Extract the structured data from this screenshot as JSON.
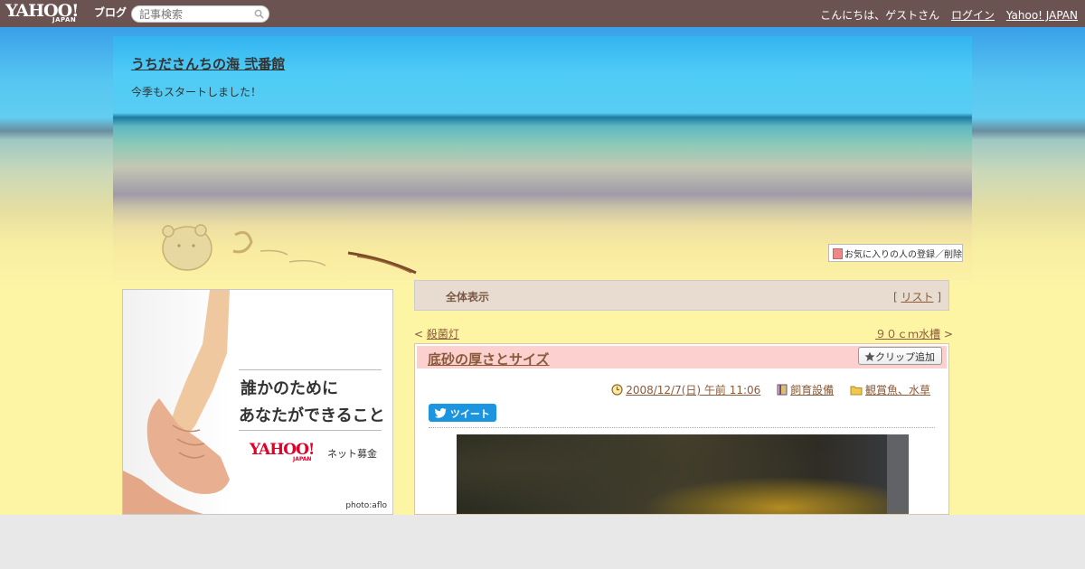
{
  "topbar": {
    "logo": "YAHOO!",
    "logo_sub": "JAPAN",
    "logo_blog": "ブログ",
    "search_placeholder": "記事検索",
    "greeting": "こんにちは、ゲストさん",
    "login_label": "ログイン",
    "yahoo_japan_label": "Yahoo! JAPAN"
  },
  "header": {
    "blog_title": "うちださんちの海 弐番館",
    "blog_description": "今季もスタートしました！",
    "favorite_label": "お気に入りの人の登録／削除"
  },
  "ad": {
    "line1": "誰かのために",
    "line2": "あなたができること",
    "brand": "YAHOO!",
    "brand_sub": "JAPAN",
    "service": "ネット募金",
    "credit": "photo:aflo"
  },
  "filter": {
    "label": "全体表示",
    "list_label": "リスト"
  },
  "nav": {
    "prev_label": "殺菌灯",
    "next_label": "９０ｃｍ水槽"
  },
  "article": {
    "title": "底砂の厚さとサイズ",
    "clip_label": "クリップ追加",
    "date": "2008/12/7(日) 午前 11:06",
    "category": "飼育設備",
    "folder": "観賞魚、水草",
    "tweet_label": "ツイート"
  },
  "colors": {
    "topbar": "#6b5352",
    "accent_link": "#8a5a3a",
    "title_bg": "#fbd0cf",
    "tweet": "#1b95e0"
  }
}
